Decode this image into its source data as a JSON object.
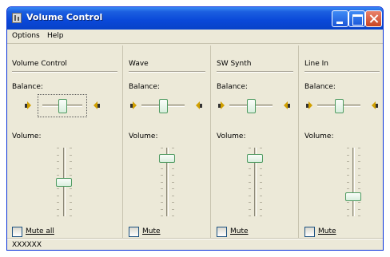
{
  "window": {
    "title": "Volume Control"
  },
  "menu": {
    "options": "Options",
    "help": "Help"
  },
  "panels": [
    {
      "name": "Volume Control",
      "balance_label": "Balance:",
      "volume_label": "Volume:",
      "mute_label": "Mute all",
      "balance": 0.5,
      "volume": 0.5,
      "muted": false
    },
    {
      "name": "Wave",
      "balance_label": "Balance:",
      "volume_label": "Volume:",
      "mute_label": "Mute",
      "balance": 0.5,
      "volume": 0.9,
      "muted": false
    },
    {
      "name": "SW Synth",
      "balance_label": "Balance:",
      "volume_label": "Volume:",
      "mute_label": "Mute",
      "balance": 0.5,
      "volume": 0.9,
      "muted": false
    },
    {
      "name": "Line In",
      "balance_label": "Balance:",
      "volume_label": "Volume:",
      "mute_label": "Mute",
      "balance": 0.5,
      "volume": 0.25,
      "muted": false
    }
  ],
  "status": {
    "text": "XXXXXX"
  },
  "colors": {
    "titlebar": "#0a48d8",
    "window_bg": "#ece9d8",
    "thumb_border": "#4f9b61",
    "speaker": "#d1a000"
  }
}
